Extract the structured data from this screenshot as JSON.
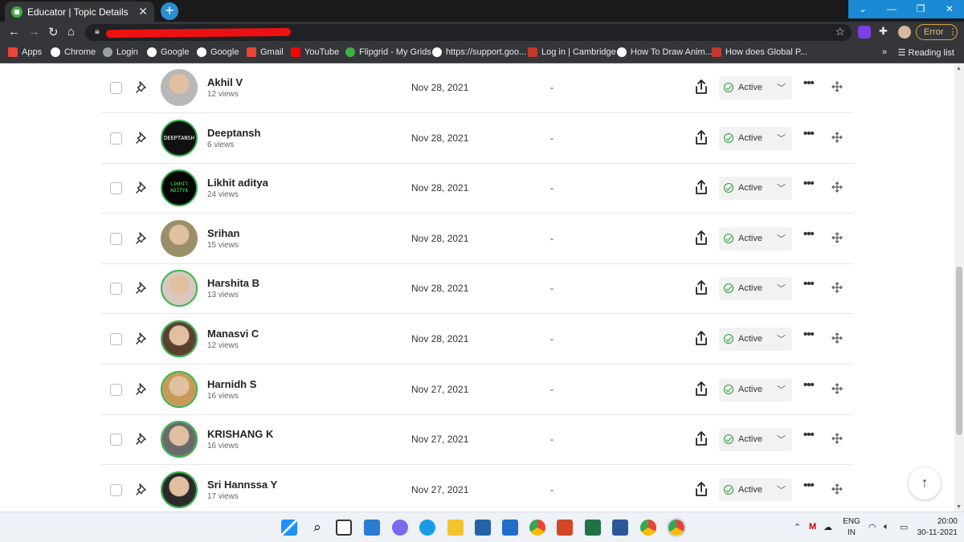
{
  "browser": {
    "tab_title": "Educator | Topic Details",
    "error_label": "Error",
    "reading_list": "Reading list",
    "bookmarks": [
      {
        "label": "Apps",
        "icon": "apps-grid-icon",
        "color": "#e8453c"
      },
      {
        "label": "Chrome",
        "icon": "google-icon",
        "color": "#ffffff"
      },
      {
        "label": "Login",
        "icon": "globe-icon",
        "color": "#9aa0a6"
      },
      {
        "label": "Google",
        "icon": "google-icon",
        "color": "#ffffff"
      },
      {
        "label": "Google",
        "icon": "google-icon",
        "color": "#ffffff"
      },
      {
        "label": "Gmail",
        "icon": "gmail-icon",
        "color": "#ea4335"
      },
      {
        "label": "YouTube",
        "icon": "youtube-icon",
        "color": "#ff0000"
      },
      {
        "label": "Flipgrid - My Grids",
        "icon": "flipgrid-icon",
        "color": "#3cb043"
      },
      {
        "label": "https://support.goo...",
        "icon": "google-icon",
        "color": "#ffffff"
      },
      {
        "label": "Log in | Cambridge",
        "icon": "cambridge-icon",
        "color": "#c0392b"
      },
      {
        "label": "How To Draw Anim...",
        "icon": "google-icon",
        "color": "#ffffff"
      },
      {
        "label": "How does Global P...",
        "icon": "cambridge-icon",
        "color": "#c0392b"
      }
    ]
  },
  "rows": [
    {
      "name": "Akhil V",
      "views": "12 views",
      "date": "Nov 28, 2021",
      "col": "-",
      "status": "Active",
      "ring": false,
      "avatar_color": "#b8b8b8"
    },
    {
      "name": "Deeptansh",
      "views": "6 views",
      "date": "Nov 28, 2021",
      "col": "-",
      "status": "Active",
      "ring": true,
      "avatar_color": "#111111",
      "avatar_text": "DEEPTANSH"
    },
    {
      "name": "Likhit aditya",
      "views": "24 views",
      "date": "Nov 28, 2021",
      "col": "-",
      "status": "Active",
      "ring": true,
      "avatar_color": "#050505",
      "avatar_text": "LIKHIT ADITYA"
    },
    {
      "name": "Srihan",
      "views": "15 views",
      "date": "Nov 28, 2021",
      "col": "-",
      "status": "Active",
      "ring": false,
      "avatar_color": "#9a8f6a"
    },
    {
      "name": "Harshita B",
      "views": "13 views",
      "date": "Nov 28, 2021",
      "col": "-",
      "status": "Active",
      "ring": true,
      "avatar_color": "#d9c7c0"
    },
    {
      "name": "Manasvi C",
      "views": "12 views",
      "date": "Nov 28, 2021",
      "col": "-",
      "status": "Active",
      "ring": true,
      "avatar_color": "#5a4030"
    },
    {
      "name": "Harnidh S",
      "views": "16 views",
      "date": "Nov 27, 2021",
      "col": "-",
      "status": "Active",
      "ring": true,
      "avatar_color": "#c89a5a"
    },
    {
      "name": "KRISHANG K",
      "views": "16 views",
      "date": "Nov 27, 2021",
      "col": "-",
      "status": "Active",
      "ring": true,
      "avatar_color": "#6a6a6a"
    },
    {
      "name": "Sri Hannssa Y",
      "views": "17 views",
      "date": "Nov 27, 2021",
      "col": "-",
      "status": "Active",
      "ring": true,
      "avatar_color": "#2a2a2a"
    }
  ],
  "taskbar": {
    "language": "ENG",
    "region": "IN",
    "time": "20:00",
    "date": "30-11-2021"
  },
  "colors": {
    "active_green": "#2a9a3a",
    "ring_green": "#34b24a",
    "chrome_dark": "#35363a",
    "window_blue": "#1a8ad4"
  }
}
